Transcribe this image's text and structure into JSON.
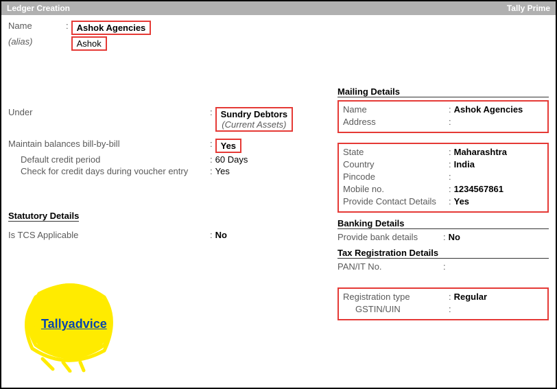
{
  "titlebar": {
    "left": "Ledger Creation",
    "right": "Tally Prime"
  },
  "header": {
    "name_label": "Name",
    "name_value": "Ashok Agencies",
    "alias_label": "(alias)",
    "alias_value": "Ashok"
  },
  "under": {
    "label": "Under",
    "value": "Sundry Debtors",
    "sub": "(Current Assets)"
  },
  "balances": {
    "maintain_label": "Maintain balances bill-by-bill",
    "maintain_value": "Yes",
    "credit_label": "Default credit period",
    "credit_value": "60 Days",
    "check_label": "Check for credit days during voucher entry",
    "check_value": "Yes"
  },
  "statutory": {
    "title": "Statutory Details",
    "tcs_label": "Is TCS Applicable",
    "tcs_value": "No"
  },
  "mailing": {
    "title": "Mailing Details",
    "name_label": "Name",
    "name_value": "Ashok Agencies",
    "address_label": "Address",
    "address_value": ""
  },
  "location": {
    "state_label": "State",
    "state_value": "Maharashtra",
    "country_label": "Country",
    "country_value": "India",
    "pincode_label": "Pincode",
    "pincode_value": "",
    "mobile_label": "Mobile no.",
    "mobile_value": "1234567861",
    "contact_label": "Provide Contact Details",
    "contact_value": "Yes"
  },
  "banking": {
    "title": "Banking Details",
    "provide_label": "Provide bank details",
    "provide_value": "No"
  },
  "tax": {
    "title": "Tax Registration Details",
    "pan_label": "PAN/IT No.",
    "pan_value": ""
  },
  "registration": {
    "type_label": "Registration type",
    "type_value": "Regular",
    "gstin_label": "GSTIN/UIN",
    "gstin_value": ""
  },
  "watermark": "Tallyadvice"
}
